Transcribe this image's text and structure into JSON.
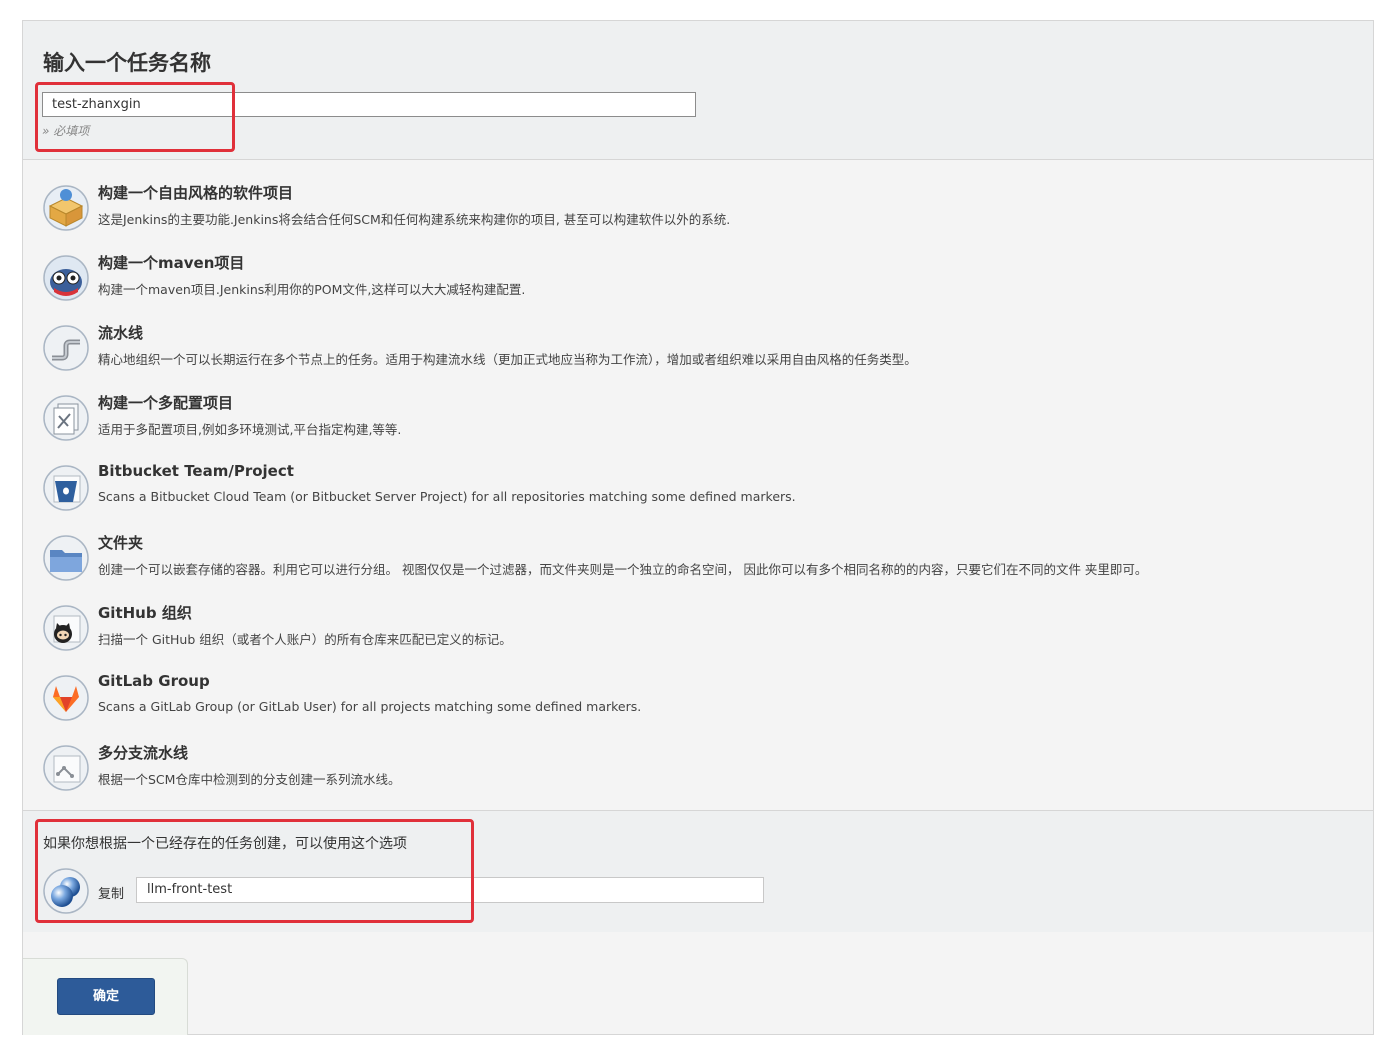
{
  "header": {
    "title": "输入一个任务名称",
    "name_value": "test-zhanxgin",
    "required_hint": "» 必填项"
  },
  "types": [
    {
      "icon": "freestyle-project-icon",
      "title": "构建一个自由风格的软件项目",
      "desc": "这是Jenkins的主要功能.Jenkins将会结合任何SCM和任何构建系统来构建你的项目, 甚至可以构建软件以外的系统."
    },
    {
      "icon": "maven-project-icon",
      "title": "构建一个maven项目",
      "desc": "构建一个maven项目.Jenkins利用你的POM文件,这样可以大大减轻构建配置."
    },
    {
      "icon": "pipeline-icon",
      "title": "流水线",
      "desc": "精心地组织一个可以长期运行在多个节点上的任务。适用于构建流水线（更加正式地应当称为工作流），增加或者组织难以采用自由风格的任务类型。"
    },
    {
      "icon": "multi-config-project-icon",
      "title": "构建一个多配置项目",
      "desc": "适用于多配置项目,例如多环境测试,平台指定构建,等等."
    },
    {
      "icon": "bitbucket-icon",
      "title": "Bitbucket Team/Project",
      "desc": "Scans a Bitbucket Cloud Team (or Bitbucket Server Project) for all repositories matching some defined markers."
    },
    {
      "icon": "folder-icon",
      "title": "文件夹",
      "desc": "创建一个可以嵌套存储的容器。利用它可以进行分组。 视图仅仅是一个过滤器，而文件夹则是一个独立的命名空间， 因此你可以有多个相同名称的的内容，只要它们在不同的文件 夹里即可。"
    },
    {
      "icon": "github-org-icon",
      "title": "GitHub 组织",
      "desc": "扫描一个 GitHub 组织（或者个人账户）的所有仓库来匹配已定义的标记。"
    },
    {
      "icon": "gitlab-icon",
      "title": "GitLab Group",
      "desc": "Scans a GitLab Group (or GitLab User) for all projects matching some defined markers."
    },
    {
      "icon": "multibranch-pipeline-icon",
      "title": "多分支流水线",
      "desc": "根据一个SCM仓库中检测到的分支创建一系列流水线。"
    }
  ],
  "copy": {
    "heading": "如果你想根据一个已经存在的任务创建，可以使用这个选项",
    "label": "复制",
    "value": "llm-front-test"
  },
  "footer": {
    "ok_label": "确定"
  },
  "colors": {
    "accent": "#2d5b99",
    "highlight": "#e0303a"
  }
}
